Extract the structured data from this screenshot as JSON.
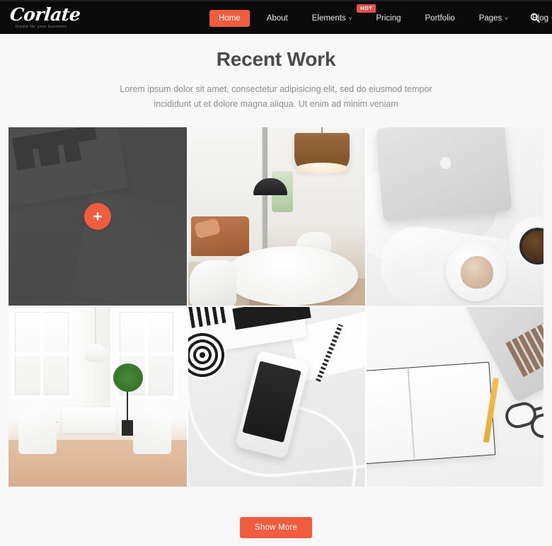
{
  "header": {
    "brand": {
      "name": "Corlate",
      "tagline": "theme for your business"
    },
    "nav": [
      {
        "label": "Home",
        "active": true,
        "caret": false,
        "badge": null
      },
      {
        "label": "About",
        "active": false,
        "caret": false,
        "badge": null
      },
      {
        "label": "Elements",
        "active": false,
        "caret": true,
        "badge": "HOT"
      },
      {
        "label": "Pricing",
        "active": false,
        "caret": false,
        "badge": null
      },
      {
        "label": "Portfolio",
        "active": false,
        "caret": false,
        "badge": null
      },
      {
        "label": "Pages",
        "active": false,
        "caret": true,
        "badge": null
      },
      {
        "label": "Blog",
        "active": false,
        "caret": true,
        "badge": null
      }
    ],
    "search_icon": "search-icon",
    "caret_glyph": "˅"
  },
  "section": {
    "title": "Recent Work",
    "subtitle": "Lorem ipsum dolor sit amet, consectetur adipisicing elit, sed do eiusmod tempor incididunt ut et dolore magna aliqua. Ut enim ad minim veniam"
  },
  "portfolio": {
    "items": [
      {
        "id": "item-1",
        "art": "art-paper",
        "alt": "Crumpled magazine print mockup on dark grey surface",
        "hovered": true,
        "plus_icon": "plus-icon"
      },
      {
        "id": "item-2",
        "art": "art-lounge",
        "alt": "Modern office lounge with brown drum pendant lamp and round white table",
        "hovered": false,
        "plus_icon": "plus-icon"
      },
      {
        "id": "item-3",
        "art": "art-bed",
        "alt": "Silver laptop on white bedding with cupcake and coffee",
        "hovered": false,
        "plus_icon": "plus-icon"
      },
      {
        "id": "item-4",
        "art": "art-room",
        "alt": "Bright white room with large windows, potted tree, white table and chairs",
        "hovered": false,
        "plus_icon": "plus-icon"
      },
      {
        "id": "item-5",
        "art": "art-flat",
        "alt": "White smartphone with earphones, magazine and pen flat lay",
        "hovered": false,
        "plus_icon": "plus-icon"
      },
      {
        "id": "item-6",
        "art": "art-desk",
        "alt": "Open blank notebook with yellow pencil, glasses and laptop",
        "hovered": false,
        "plus_icon": "plus-icon"
      }
    ]
  },
  "footer": {
    "show_more_label": "Show More"
  },
  "colors": {
    "accent": "#ef5c3e",
    "header_bg": "#0a0a0a",
    "page_bg": "#f8f8f8",
    "badge": "#e8504a",
    "heading": "#4a4a4a",
    "body_text": "#8d8d8d"
  }
}
